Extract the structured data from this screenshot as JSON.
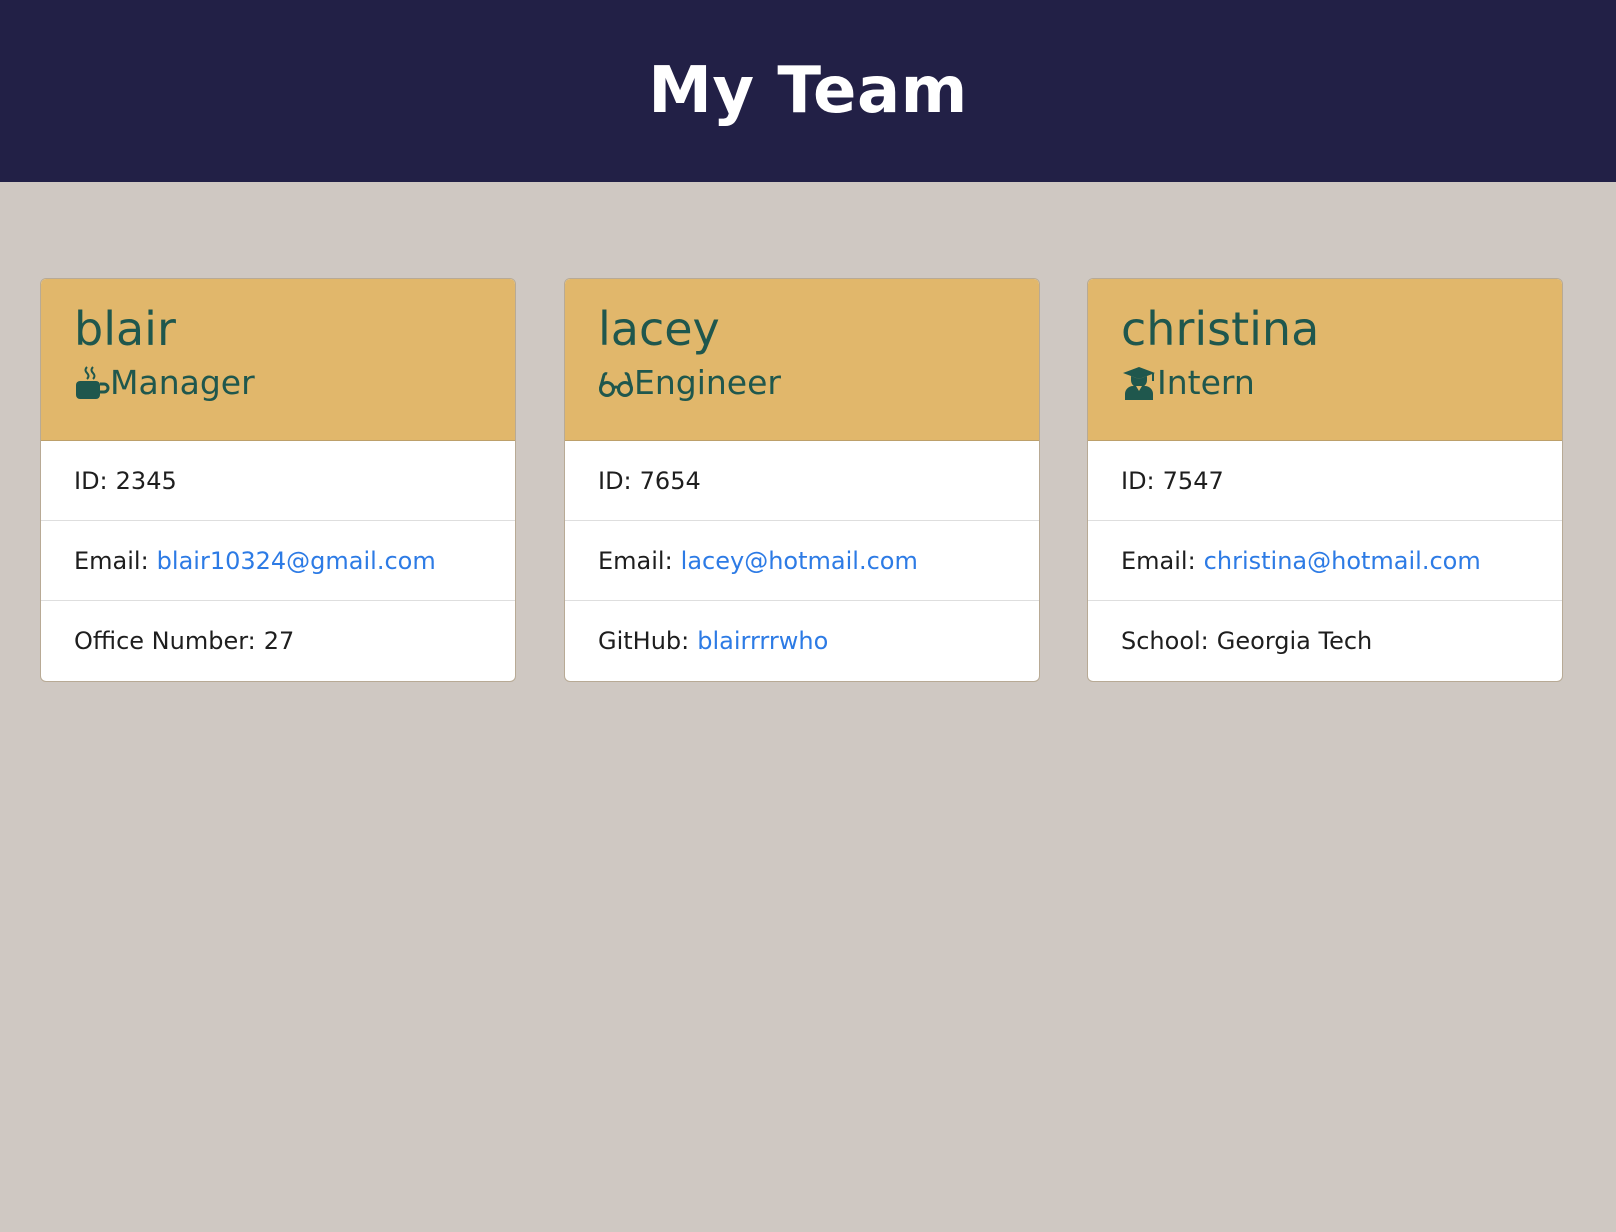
{
  "header": {
    "title": "My Team"
  },
  "cards": [
    {
      "name": "blair",
      "role": "Manager",
      "role_icon": "coffee-mug-icon",
      "id_label": "ID:",
      "id_value": "2345",
      "email_label": "Email:",
      "email": "blair10324@gmail.com",
      "extra_label": "Office Number:",
      "extra_value": "27"
    },
    {
      "name": "lacey",
      "role": "Engineer",
      "role_icon": "glasses-icon",
      "id_label": "ID:",
      "id_value": "7654",
      "email_label": "Email:",
      "email": "lacey@hotmail.com",
      "extra_label": "GitHub:",
      "extra_value": "blairrrrwho"
    },
    {
      "name": "christina",
      "role": "Intern",
      "role_icon": "graduate-icon",
      "id_label": "ID:",
      "id_value": "7547",
      "email_label": "Email:",
      "email": "christina@hotmail.com",
      "extra_label": "School:",
      "extra_value": "Georgia Tech"
    }
  ],
  "colors": {
    "header_bg": "#222046",
    "page_bg": "#cfc8c2",
    "card_head_bg": "#e1b76b",
    "card_head_text": "#1f574d",
    "link": "#2d7be5"
  }
}
